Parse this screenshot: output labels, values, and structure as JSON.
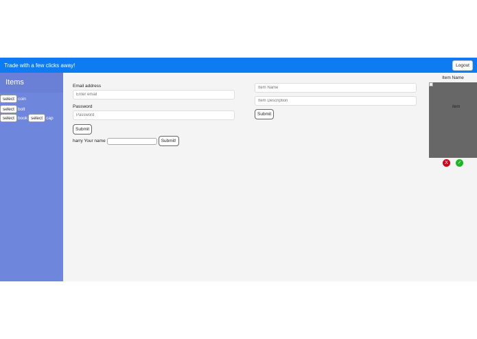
{
  "header": {
    "tagline": "Trade with a few clicks away!",
    "logout_label": "Logout"
  },
  "sidebar": {
    "title": "Items",
    "select_label": "select",
    "items": [
      "coin",
      "bolt",
      "book",
      "cap"
    ]
  },
  "login_form": {
    "email_label": "Email address",
    "email_placeholder": "Enter email",
    "password_label": "Password",
    "password_placeholder": "Password",
    "submit_label": "Submit",
    "name_prefix": "harry Your name",
    "name_value": "",
    "name_submit_label": "Submit!"
  },
  "item_form": {
    "name_placeholder": "Item Name",
    "description_placeholder": "Item Description",
    "submit_label": "Submit"
  },
  "item_card": {
    "title": "Item Name",
    "image_alt": "item",
    "reject_symbol": "X",
    "accept_symbol": "✓",
    "reject_color": "#d0021b",
    "accept_color": "#1fb624"
  },
  "colors": {
    "topbar": "#0d7cf2",
    "sidebar": "#6f86dd",
    "main_bg": "#f4f4f4"
  }
}
